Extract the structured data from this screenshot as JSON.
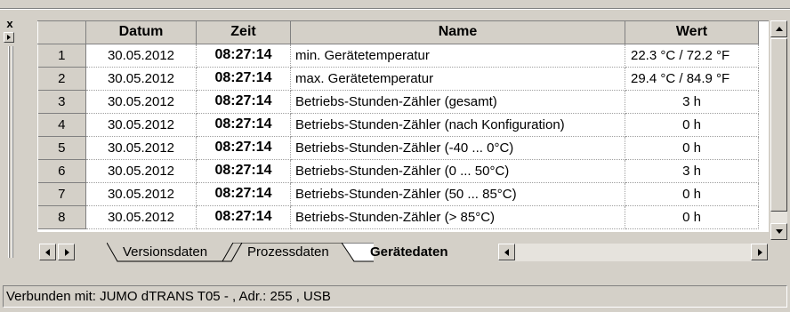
{
  "window": {
    "close_label": "x"
  },
  "grid": {
    "columns": [
      "Datum",
      "Zeit",
      "Name",
      "Wert"
    ],
    "rows": [
      {
        "num": "1",
        "datum": "30.05.2012",
        "zeit": "08:27:14",
        "name": "min. Gerätetemperatur",
        "wert": "22.3 °C / 72.2 °F"
      },
      {
        "num": "2",
        "datum": "30.05.2012",
        "zeit": "08:27:14",
        "name": "max. Gerätetemperatur",
        "wert": "29.4 °C / 84.9 °F"
      },
      {
        "num": "3",
        "datum": "30.05.2012",
        "zeit": "08:27:14",
        "name": "Betriebs-Stunden-Zähler (gesamt)",
        "wert": "3 h"
      },
      {
        "num": "4",
        "datum": "30.05.2012",
        "zeit": "08:27:14",
        "name": "Betriebs-Stunden-Zähler (nach Konfiguration)",
        "wert": "0 h"
      },
      {
        "num": "5",
        "datum": "30.05.2012",
        "zeit": "08:27:14",
        "name": "Betriebs-Stunden-Zähler (-40 ... 0°C)",
        "wert": "0 h"
      },
      {
        "num": "6",
        "datum": "30.05.2012",
        "zeit": "08:27:14",
        "name": "Betriebs-Stunden-Zähler (0 ... 50°C)",
        "wert": "3 h"
      },
      {
        "num": "7",
        "datum": "30.05.2012",
        "zeit": "08:27:14",
        "name": "Betriebs-Stunden-Zähler (50 ... 85°C)",
        "wert": "0 h"
      },
      {
        "num": "8",
        "datum": "30.05.2012",
        "zeit": "08:27:14",
        "name": "Betriebs-Stunden-Zähler (> 85°C)",
        "wert": "0 h"
      }
    ]
  },
  "tabs": [
    {
      "label": "Versionsdaten",
      "active": false
    },
    {
      "label": "Prozessdaten",
      "active": false
    },
    {
      "label": "Gerätedaten",
      "active": true
    }
  ],
  "status": {
    "text": "Verbunden mit: JUMO dTRANS T05 -  , Adr.: 255 , USB"
  },
  "icons": [
    "close-icon",
    "arrow-right-icon",
    "scroll-up-icon",
    "scroll-down-icon",
    "tab-prev-icon",
    "tab-next-icon",
    "scroll-left-icon",
    "scroll-right-icon"
  ]
}
